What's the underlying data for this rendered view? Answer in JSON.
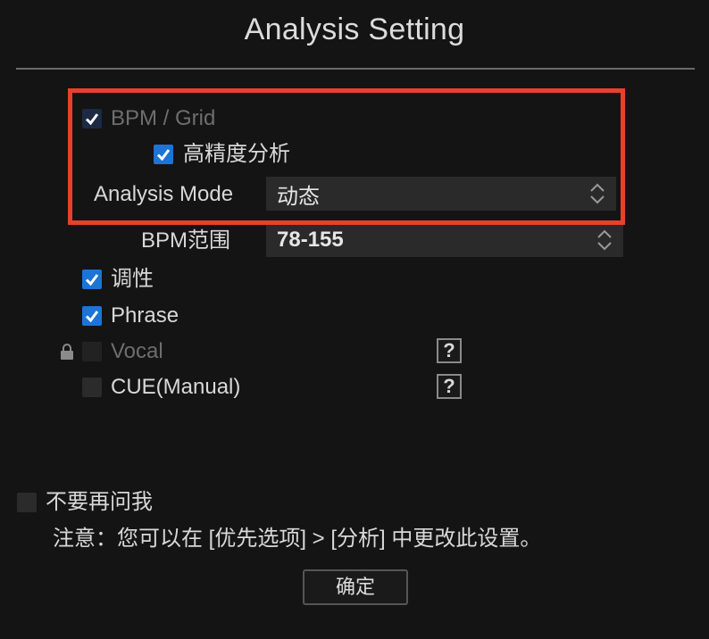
{
  "dialog": {
    "title": "Analysis Setting"
  },
  "options": {
    "bpm_grid": {
      "label": "BPM / Grid",
      "checked": true
    },
    "high_precision": {
      "label": "高精度分析",
      "checked": true
    },
    "analysis_mode": {
      "label": "Analysis Mode",
      "value": "动态"
    },
    "bpm_range": {
      "label": "BPM范围",
      "value": "78-155"
    },
    "key": {
      "label": "调性",
      "checked": true
    },
    "phrase": {
      "label": "Phrase",
      "checked": true
    },
    "vocal": {
      "label": "Vocal",
      "checked": false,
      "locked": true,
      "help": "?"
    },
    "cue_manual": {
      "label": "CUE(Manual)",
      "checked": false,
      "help": "?"
    }
  },
  "footer": {
    "dont_ask_label": "不要再问我",
    "note": "注意：您可以在 [优先选项] > [分析] 中更改此设置。",
    "ok_label": "确定"
  },
  "colors": {
    "highlight": "#e8402c",
    "checkbox_on": "#1e73d6"
  }
}
